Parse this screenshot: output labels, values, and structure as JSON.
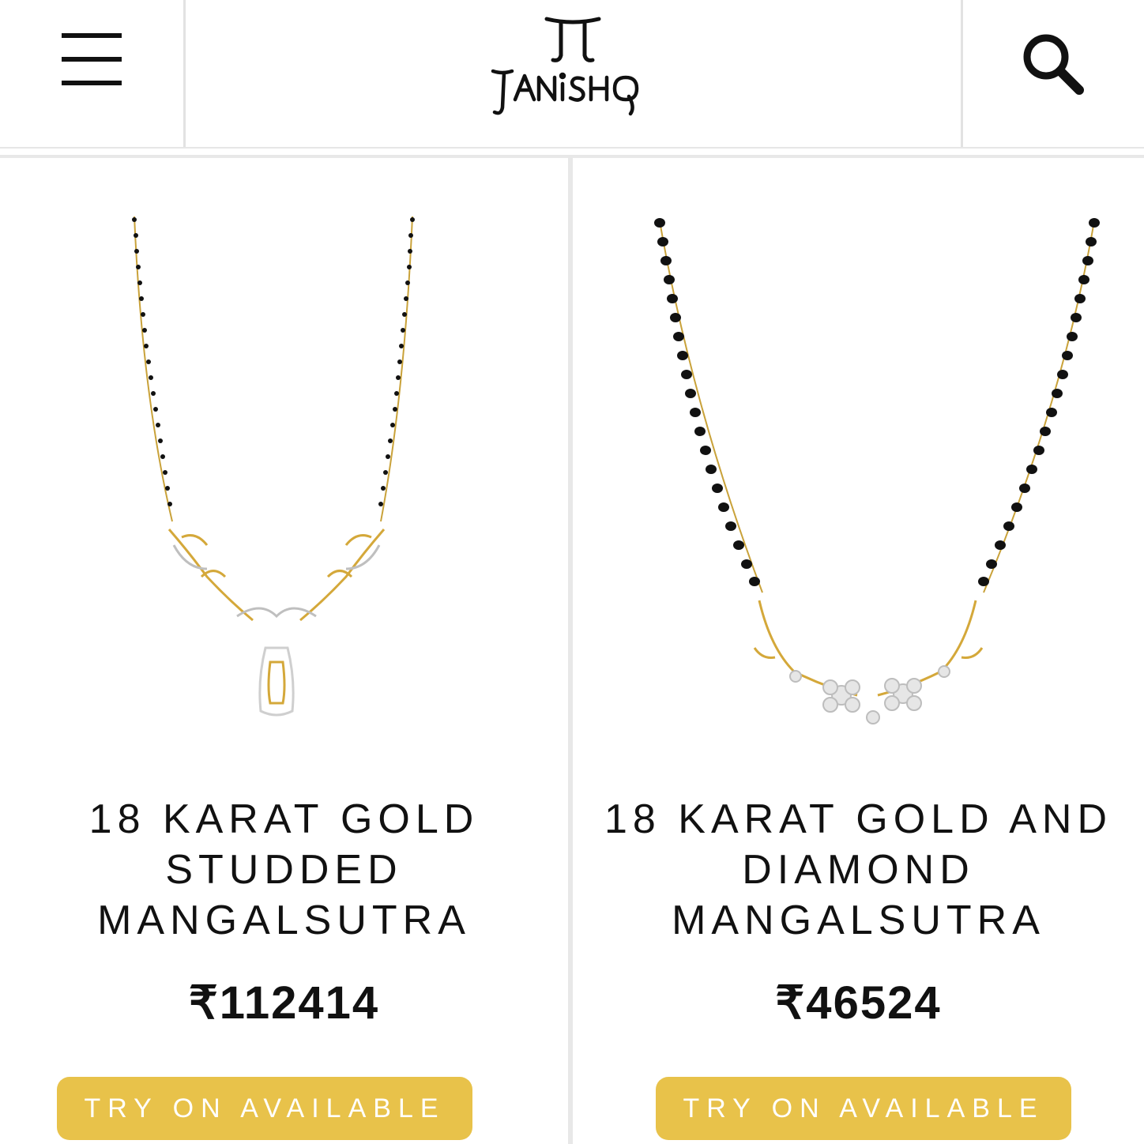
{
  "header": {
    "menu_icon": "hamburger-menu-icon",
    "logo_text": "TANISHQ",
    "search_icon": "search-icon"
  },
  "products": [
    {
      "name_lines": [
        "18 KARAT GOLD",
        "STUDDED",
        "MANGALSUTRA"
      ],
      "price": "₹112414",
      "try_on_label": "TRY ON AVAILABLE"
    },
    {
      "name_lines": [
        "18 KARAT GOLD AND",
        "DIAMOND",
        "MANGALSUTRA"
      ],
      "price": "₹46524",
      "try_on_label": "TRY ON AVAILABLE"
    }
  ],
  "colors": {
    "accent_gold": "#e8c24a",
    "text": "#111111",
    "divider": "#e2e2e2"
  }
}
